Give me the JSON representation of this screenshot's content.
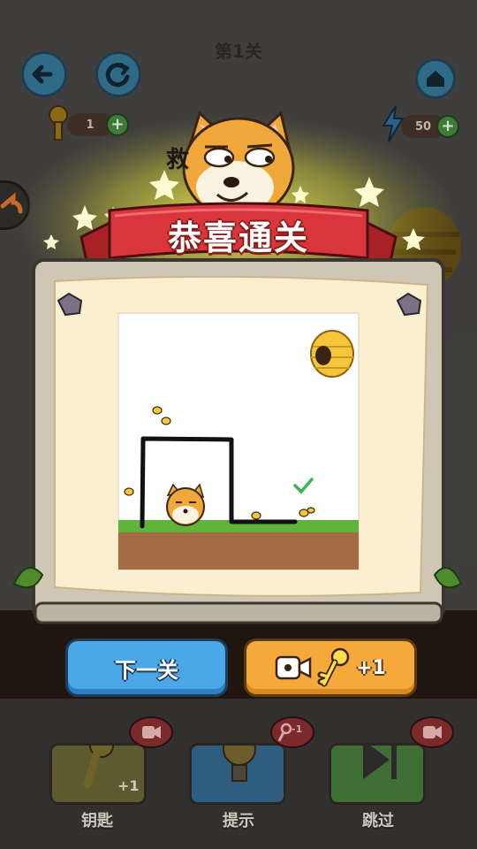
{
  "header": {
    "level_title": "第1关"
  },
  "hud": {
    "keys_count": "1",
    "energy_count": "50"
  },
  "popup": {
    "banner_title": "恭喜通关",
    "next_button_label": "下一关",
    "video_reward_label": "+1"
  },
  "bottom_bar": {
    "key_label": "钥匙",
    "key_reward": "+1",
    "hint_label": "提示",
    "hint_cost": "-1",
    "skip_label": "跳过"
  },
  "background_text": "救",
  "colors": {
    "banner_red": "#d8363a",
    "next_blue": "#4aa8e8",
    "video_orange": "#f4a93a",
    "grass": "#5fb53a",
    "soil": "#a56b45"
  }
}
